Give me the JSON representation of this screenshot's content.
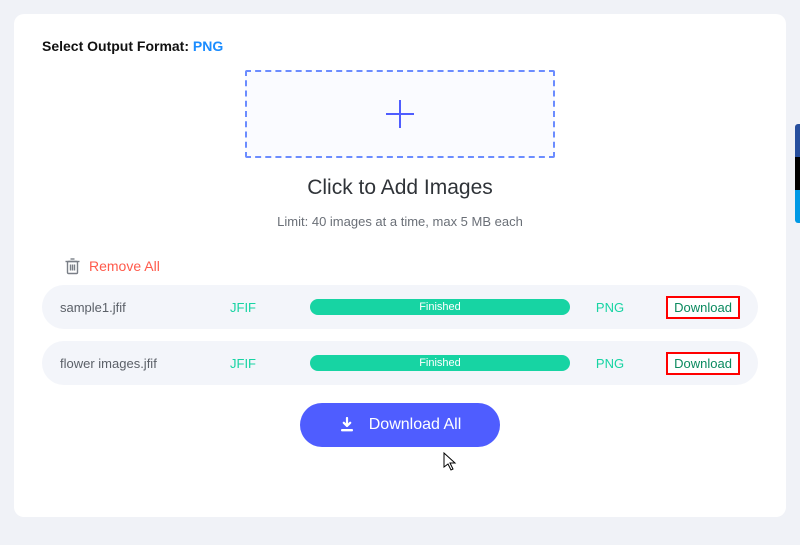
{
  "header": {
    "label": "Select Output Format:",
    "format": "PNG"
  },
  "dropzone": {
    "title": "Click to Add Images",
    "limit": "Limit: 40 images at a time, max 5 MB each"
  },
  "remove_all": "Remove All",
  "files": [
    {
      "name": "sample1.jfif",
      "src_fmt": "JFIF",
      "status": "Finished",
      "dst_fmt": "PNG",
      "download": "Download"
    },
    {
      "name": "flower images.jfif",
      "src_fmt": "JFIF",
      "status": "Finished",
      "dst_fmt": "PNG",
      "download": "Download"
    }
  ],
  "download_all": "Download All"
}
